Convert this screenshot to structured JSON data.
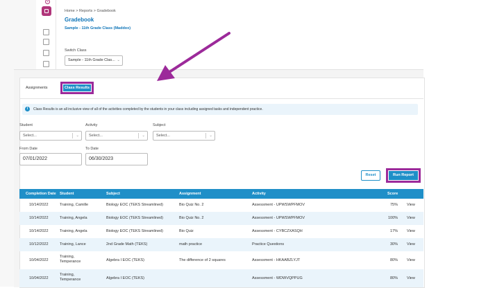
{
  "breadcrumb": {
    "home": "Home",
    "sep1": ">",
    "reports": "Reports",
    "sep2": ">",
    "current": "Gradebook"
  },
  "page": {
    "title": "Gradebook",
    "subtitle": "Sample - 11th Grade Class (Maddox)"
  },
  "switch_class": {
    "label": "Switch Class",
    "value": "Sample - 11th Grade Clas...",
    "chevron": "⌄"
  },
  "tabs": [
    {
      "label": "Assignments",
      "active": false
    },
    {
      "label": "Class Results",
      "active": true
    }
  ],
  "info_text": "Class Results is an all inclusive view of all of the activities completed by the students in your class including assigned tasks and independent practice.",
  "info_icon": "i",
  "filters": {
    "student": {
      "label": "Student",
      "placeholder": "Select..."
    },
    "activity": {
      "label": "Activity",
      "placeholder": "Select..."
    },
    "subject": {
      "label": "Subject",
      "placeholder": "Select..."
    },
    "chevron": "⌄",
    "from_date": {
      "label": "From Date",
      "value": "07/01/2022"
    },
    "to_date": {
      "label": "To Date",
      "value": "06/30/2023"
    }
  },
  "buttons": {
    "reset": "Reset",
    "run_report": "Run Report"
  },
  "table": {
    "headers": [
      "Completion Date",
      "Student",
      "Subject",
      "Assignment",
      "Activity",
      "Score"
    ],
    "rows": [
      {
        "date": "10/14/2022",
        "student": "Training, Camille",
        "subject": "Biology EOC (TEKS Streamlined)",
        "assignment": "Bio Quiz No. 2",
        "activity": "Assessment - UPWSWPFMOV",
        "score": "75%",
        "action": "View"
      },
      {
        "date": "10/14/2022",
        "student": "Training, Angela",
        "subject": "Biology EOC (TEKS Streamlined)",
        "assignment": "Bio Quiz No. 2",
        "activity": "Assessment - UPWSWPFMOV",
        "score": "100%",
        "action": "View"
      },
      {
        "date": "10/14/2022",
        "student": "Training, Angela",
        "subject": "Biology EOC (TEKS Streamlined)",
        "assignment": "Bio Quiz",
        "activity": "Assessment - CYBCZXASQH",
        "score": "17%",
        "action": "View"
      },
      {
        "date": "10/12/2022",
        "student": "Training, Lance",
        "subject": "2nd Grade Math (TEKS)",
        "assignment": "math practice",
        "activity": "Practice Questions",
        "score": "30%",
        "action": "View"
      },
      {
        "date": "10/04/2022",
        "student": "Training, Temperance",
        "subject": "Algebra I EOC (TEKS)",
        "assignment": "The difference of 2 squares",
        "activity": "Assessment - HKAABZLYJT",
        "score": "80%",
        "action": "View"
      },
      {
        "date": "10/04/2022",
        "student": "Training, Temperance",
        "subject": "Algebra I EOC (TEKS)",
        "assignment": "",
        "activity": "Assessment - WDWVQPPUG",
        "score": "80%",
        "action": "View"
      }
    ]
  },
  "colors": {
    "accent": "#1f8fc8",
    "highlight": "#9c2a9a",
    "rail_active": "#b0357a",
    "row_alt": "#eaf4fb"
  },
  "icons": [
    "plus-circle-icon",
    "gradebook-icon",
    "classroom-icon",
    "monitor-icon",
    "card-icon",
    "id-card-icon",
    "document-icon"
  ]
}
